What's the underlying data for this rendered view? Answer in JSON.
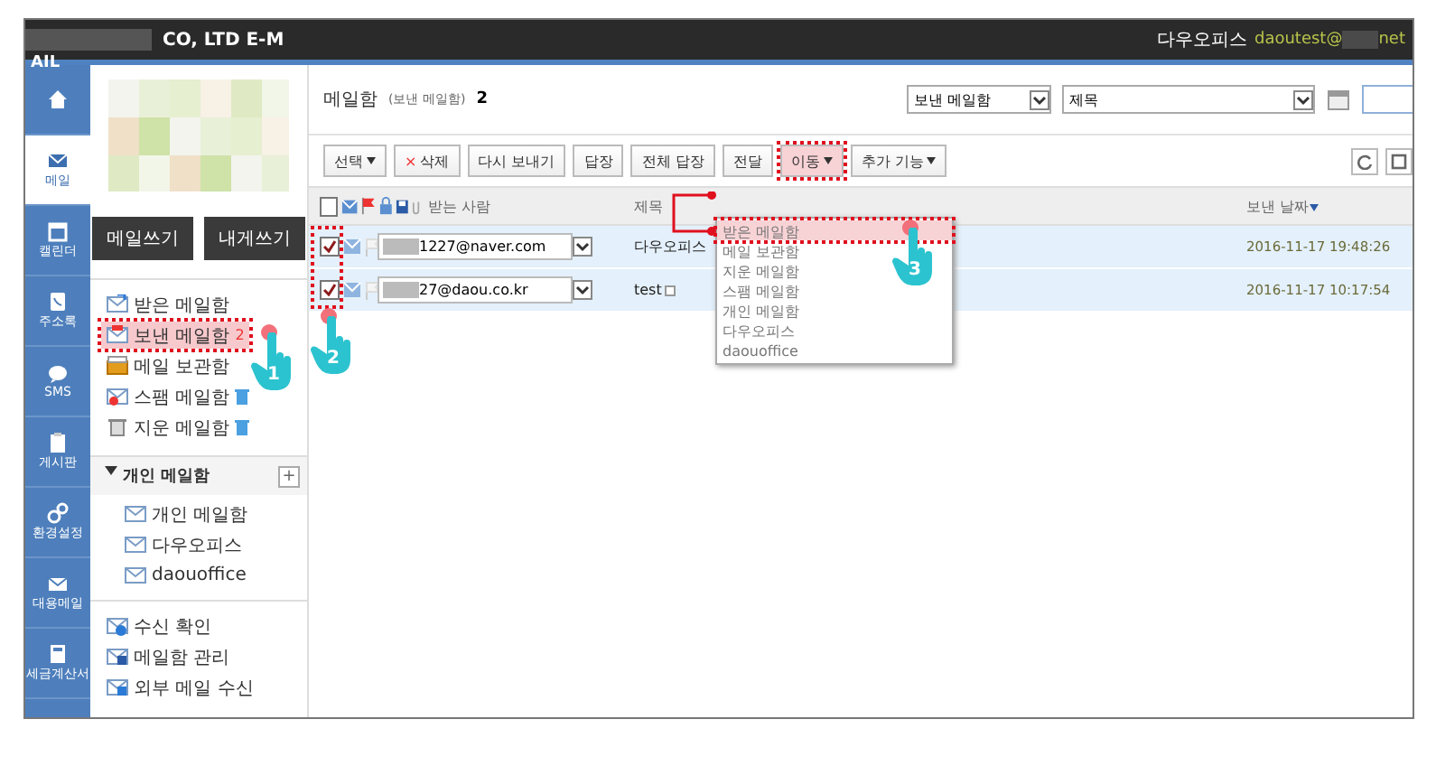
{
  "topbar": {
    "rail_label": "AIL",
    "company": "CO, LTD E-M",
    "product": "다우오피스",
    "user": "daoutest@",
    "user_suffix": "net"
  },
  "rail": [
    {
      "selected": false
    },
    {
      "label": "메일",
      "selected": true
    },
    {
      "label": "캘린더",
      "selected": false
    },
    {
      "label": "주소록",
      "selected": false
    },
    {
      "label": "SMS",
      "selected": false
    },
    {
      "label": "게시판",
      "selected": false
    },
    {
      "label": "환경설정",
      "selected": false
    },
    {
      "label": "대용메일",
      "selected": false
    },
    {
      "label": "세금계산서",
      "selected": false
    }
  ],
  "sidebar": {
    "buttons": [
      "메일쓰기",
      "내게쓰기"
    ],
    "folders": [
      {
        "label": "받은 메일함",
        "selected": false
      },
      {
        "label": "보낸 메일함",
        "count": "2",
        "selected": true,
        "highlighted": true,
        "step": "1"
      },
      {
        "label": "메일 보관함",
        "selected": false
      },
      {
        "label": "스팸 메일함",
        "selected": false,
        "trash": true
      },
      {
        "label": "지운 메일함",
        "selected": false,
        "trash": true
      }
    ],
    "personal": {
      "title": "개인 메일함",
      "expanded": true,
      "add": "+",
      "items": [
        "개인 메일함",
        "다우오피스",
        "daouoffice"
      ]
    },
    "tools": [
      "수신 확인",
      "메일함 관리",
      "외부 메일 수신"
    ]
  },
  "main": {
    "title": "메일함",
    "subtitle": "(보낸 메일함)",
    "count": "2",
    "filter_folder": "보낸 메일함",
    "filter_field": "제목",
    "toolbar": [
      {
        "label": "선택",
        "kind": "menu"
      },
      {
        "label": "삭제",
        "kind": "delete",
        "mark": "×"
      },
      {
        "label": "다시 보내기",
        "kind": "plain"
      },
      {
        "label": "답장",
        "kind": "plain"
      },
      {
        "label": "전체 답장",
        "kind": "plain"
      },
      {
        "label": "전달",
        "kind": "plain"
      },
      {
        "label": "이동",
        "kind": "menu",
        "highlighted": true
      },
      {
        "label": "추가 기능",
        "kind": "menu"
      }
    ],
    "columns": [
      "받는 사람",
      "제목",
      "보낸 날짜"
    ],
    "select_all_checked": false,
    "checkbox_step": "2",
    "rows": [
      {
        "checked": true,
        "recipient": "1227@naver.com",
        "subject": "다우오피스",
        "attachment": false,
        "date": "2016-11-17 19:48:26"
      },
      {
        "checked": true,
        "recipient": "27@daou.co.kr",
        "subject": "test",
        "attachment": true,
        "date": "2016-11-17 10:17:54"
      }
    ],
    "move_menu": [
      {
        "label": "받은 메일함",
        "selected": true,
        "step": "3"
      },
      {
        "label": "메일 보관함",
        "selected": false
      },
      {
        "label": "지운 메일함",
        "selected": false
      },
      {
        "label": "스팸 메일함",
        "selected": false
      },
      {
        "label": "개인 메일함",
        "selected": false
      },
      {
        "label": "다우오피스",
        "selected": false
      },
      {
        "label": "daouoffice",
        "selected": false
      }
    ]
  }
}
